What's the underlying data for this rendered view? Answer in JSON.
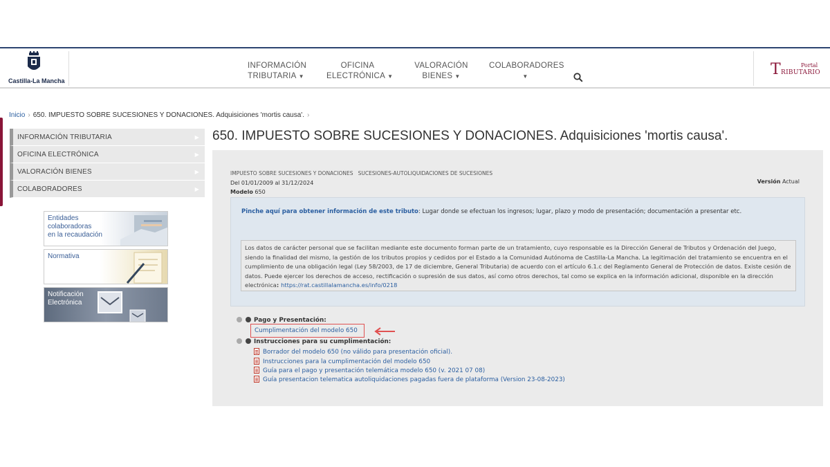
{
  "header": {
    "logo_text": "Castilla-La Mancha",
    "nav": [
      {
        "line1": "INFORMACIÓN",
        "line2": "TRIBUTARIA"
      },
      {
        "line1": "OFICINA",
        "line2": "ELECTRÓNICA"
      },
      {
        "line1": "VALORACIÓN",
        "line2": "BIENES"
      },
      {
        "line1": "COLABORADORES",
        "line2": ""
      }
    ],
    "portal_small": "Portal",
    "portal_big_letter": "T",
    "portal_rest": "RIBUTARIO"
  },
  "breadcrumb": {
    "home": "Inicio",
    "current": "650. IMPUESTO SOBRE SUCESIONES Y DONACIONES. Adquisiciones 'mortis causa'."
  },
  "sidebar": {
    "items": [
      {
        "label": "INFORMACIÓN TRIBUTARIA"
      },
      {
        "label": "OFICINA ELECTRÓNICA"
      },
      {
        "label": "VALORACIÓN BIENES"
      },
      {
        "label": "COLABORADORES"
      }
    ],
    "promos": [
      {
        "text": "Entidades colaboradoras en la recaudación",
        "l1": "Entidades",
        "l2": "colaboradoras",
        "l3": "en la recaudación"
      },
      {
        "text": "Normativa",
        "l1": "Normativa"
      },
      {
        "text": "Notificación Electrónica",
        "l1": "Notificación",
        "l2": "Electrónica"
      }
    ]
  },
  "main": {
    "title": "650. IMPUESTO SOBRE SUCESIONES Y DONACIONES. Adquisiciones 'mortis causa'.",
    "categories": "IMPUESTO SOBRE SUCESIONES Y DONACIONES   SUCESIONES-AUTOLIQUIDACIONES DE SUCESIONES",
    "dates": "Del 01/01/2009 al 31/12/2024",
    "version_label": "Versión",
    "version_value": "Actual",
    "model_label": "Modelo",
    "model_value": "650",
    "info_link_bold": "Pinche aquí para obtener información de este tributo",
    "info_link_rest": ": Lugar donde se efectuan los ingresos; lugar, plazo y modo de presentación; documentación a presentar etc.",
    "privacy_text": "Los datos de carácter personal que se facilitan mediante este documento forman parte de un tratamiento, cuyo responsable es la Dirección General de Tributos y Ordenación del Juego, siendo la finalidad del mismo, la gestión de los tributos propios y cedidos por el Estado a la Comunidad Autónoma de Castilla-La Mancha. La legitimación del tratamiento se encuentra en el cumplimiento de una obligación legal (Ley 58/2003, de 17 de diciembre, General Tributaria) de acuerdo con el artículo 6.1.c del Reglamento General de Protección de datos. Existe cesión de datos. Puede ejercer los derechos de acceso, rectificación o supresión de sus datos, así como otros derechos, tal como se explica en la información adicional, disponible en la dirección electrónica",
    "privacy_colon": ": ",
    "privacy_url": "https://rat.castillalamancha.es/info/0218",
    "section1_title": "Pago y Presentación:",
    "section1_link": "Cumplimentación del modelo 650",
    "section2_title": "Instrucciones para su cumplimentación:",
    "documents": [
      {
        "label": "Borrador del modelo 650 (no válido para presentación oficial)."
      },
      {
        "label": "Instrucciones para la cumplimentación del modelo 650"
      },
      {
        "label": "Guía para el pago y presentación telemática modelo 650 (v. 2021 07 08)"
      },
      {
        "label": "Guía presentacion telematica autoliquidaciones pagadas fuera de plataforma (Version 23-08-2023)"
      }
    ]
  },
  "colors": {
    "brand_navy": "#2b4470",
    "brand_burgundy": "#8a1538",
    "link_blue": "#2a5ea0",
    "highlight_red": "#e05050"
  }
}
